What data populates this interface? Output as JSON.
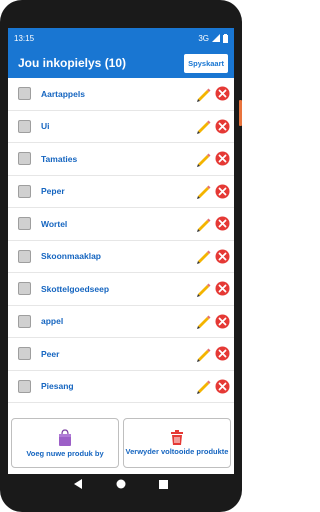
{
  "status": {
    "time": "13:15",
    "network": "3G"
  },
  "appbar": {
    "title": "Jou inkopielys (10)",
    "menu_button": "Spyskaart"
  },
  "items": [
    {
      "label": "Aartappels"
    },
    {
      "label": "Ui"
    },
    {
      "label": "Tamaties"
    },
    {
      "label": "Peper"
    },
    {
      "label": "Wortel"
    },
    {
      "label": "Skoonmaaklap"
    },
    {
      "label": "Skottelgoedseep"
    },
    {
      "label": "appel"
    },
    {
      "label": "Peer"
    },
    {
      "label": "Piesang"
    }
  ],
  "footer": {
    "add_label": "Voeg nuwe produk by",
    "remove_label": "Verwyder voltooide produkte"
  },
  "colors": {
    "primary": "#1976d2",
    "label": "#1565c0",
    "delete": "#e53935"
  },
  "icons": {
    "edit": "pencil-icon",
    "delete": "delete-x-icon",
    "add": "shopping-bag-icon",
    "remove": "trash-icon"
  }
}
